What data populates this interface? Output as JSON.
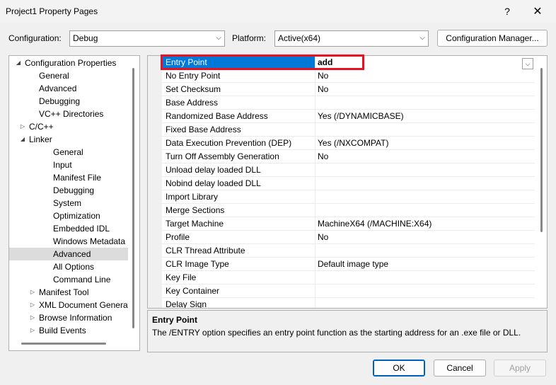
{
  "window": {
    "title": "Project1 Property Pages",
    "help_label": "?",
    "close_label": "✕"
  },
  "config_bar": {
    "configuration_label": "Configuration:",
    "configuration_value": "Debug",
    "platform_label": "Platform:",
    "platform_value": "Active(x64)",
    "manager_button": "Configuration Manager..."
  },
  "tree": [
    {
      "label": "Configuration Properties",
      "twisty": "◢"
    },
    {
      "label": "General"
    },
    {
      "label": "Advanced"
    },
    {
      "label": "Debugging"
    },
    {
      "label": "VC++ Directories"
    },
    {
      "label": "C/C++",
      "twisty": "▷"
    },
    {
      "label": "Linker",
      "twisty": "◢"
    },
    {
      "label": "General"
    },
    {
      "label": "Input"
    },
    {
      "label": "Manifest File"
    },
    {
      "label": "Debugging"
    },
    {
      "label": "System"
    },
    {
      "label": "Optimization"
    },
    {
      "label": "Embedded IDL"
    },
    {
      "label": "Windows Metadata"
    },
    {
      "label": "Advanced",
      "selected": true
    },
    {
      "label": "All Options"
    },
    {
      "label": "Command Line"
    },
    {
      "label": "Manifest Tool",
      "twisty": "▷"
    },
    {
      "label": "XML Document Generator",
      "twisty": "▷"
    },
    {
      "label": "Browse Information",
      "twisty": "▷"
    },
    {
      "label": "Build Events",
      "twisty": "▷"
    }
  ],
  "properties": [
    {
      "name": "Entry Point",
      "value": "add",
      "selected": true
    },
    {
      "name": "No Entry Point",
      "value": "No"
    },
    {
      "name": "Set Checksum",
      "value": "No"
    },
    {
      "name": "Base Address",
      "value": ""
    },
    {
      "name": "Randomized Base Address",
      "value": "Yes (/DYNAMICBASE)"
    },
    {
      "name": "Fixed Base Address",
      "value": ""
    },
    {
      "name": "Data Execution Prevention (DEP)",
      "value": "Yes (/NXCOMPAT)"
    },
    {
      "name": "Turn Off Assembly Generation",
      "value": "No"
    },
    {
      "name": "Unload delay loaded DLL",
      "value": ""
    },
    {
      "name": "Nobind delay loaded DLL",
      "value": ""
    },
    {
      "name": "Import Library",
      "value": ""
    },
    {
      "name": "Merge Sections",
      "value": ""
    },
    {
      "name": "Target Machine",
      "value": "MachineX64 (/MACHINE:X64)"
    },
    {
      "name": "Profile",
      "value": "No"
    },
    {
      "name": "CLR Thread Attribute",
      "value": ""
    },
    {
      "name": "CLR Image Type",
      "value": "Default image type"
    },
    {
      "name": "Key File",
      "value": ""
    },
    {
      "name": "Key Container",
      "value": ""
    },
    {
      "name": "Delay Sign",
      "value": ""
    }
  ],
  "description": {
    "title": "Entry Point",
    "text": "The /ENTRY option specifies an entry point function as the starting address for an .exe file or DLL."
  },
  "buttons": {
    "ok": "OK",
    "cancel": "Cancel",
    "apply": "Apply"
  },
  "colors": {
    "selection": "#0078d7",
    "highlight_border": "#e81123"
  }
}
